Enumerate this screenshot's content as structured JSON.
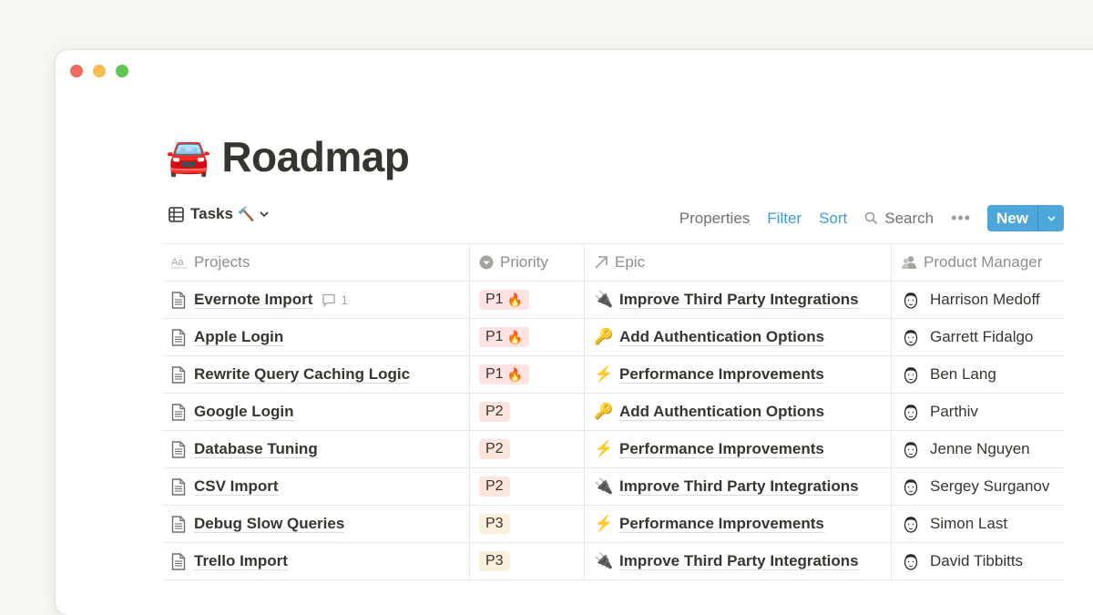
{
  "window": {
    "traffic_lights": [
      {
        "name": "close",
        "color": "#ec6a5e"
      },
      {
        "name": "minimize",
        "color": "#f4bf4f"
      },
      {
        "name": "zoom",
        "color": "#61c554"
      }
    ]
  },
  "page": {
    "emoji": "🚘",
    "title": "Roadmap"
  },
  "toolbar": {
    "view_icon": "table-icon",
    "view_label": "Tasks",
    "view_emoji": "🔨",
    "properties_label": "Properties",
    "filter_label": "Filter",
    "sort_label": "Sort",
    "search_label": "Search",
    "more_label": "•••",
    "new_label": "New",
    "accent_color": "#4ea7da"
  },
  "table": {
    "columns": [
      {
        "label": "Projects",
        "icon": "text-property-icon"
      },
      {
        "label": "Priority",
        "icon": "select-property-icon"
      },
      {
        "label": "Epic",
        "icon": "relation-arrow-icon"
      },
      {
        "label": "Product Manager",
        "icon": "person-property-icon"
      }
    ],
    "priority_colors": {
      "P1": "#ffe2e2",
      "P2": "#fde4dc",
      "P3": "#fbf0dc"
    },
    "rows": [
      {
        "project": "Evernote Import",
        "comments": "1",
        "priority": "P1",
        "priority_emoji": "🔥",
        "epic": "Improve Third Party Integrations",
        "epic_emoji": "🔌",
        "pm": "Harrison Medoff"
      },
      {
        "project": "Apple Login",
        "comments": "",
        "priority": "P1",
        "priority_emoji": "🔥",
        "epic": "Add Authentication Options",
        "epic_emoji": "🔑",
        "pm": "Garrett Fidalgo"
      },
      {
        "project": "Rewrite Query Caching Logic",
        "comments": "",
        "priority": "P1",
        "priority_emoji": "🔥",
        "epic": "Performance Improvements",
        "epic_emoji": "⚡",
        "pm": "Ben Lang"
      },
      {
        "project": "Google Login",
        "comments": "",
        "priority": "P2",
        "priority_emoji": "",
        "epic": "Add Authentication Options",
        "epic_emoji": "🔑",
        "pm": "Parthiv"
      },
      {
        "project": "Database Tuning",
        "comments": "",
        "priority": "P2",
        "priority_emoji": "",
        "epic": "Performance Improvements",
        "epic_emoji": "⚡",
        "pm": "Jenne Nguyen"
      },
      {
        "project": "CSV Import",
        "comments": "",
        "priority": "P2",
        "priority_emoji": "",
        "epic": "Improve Third Party Integrations",
        "epic_emoji": "🔌",
        "pm": "Sergey Surganov"
      },
      {
        "project": "Debug Slow Queries",
        "comments": "",
        "priority": "P3",
        "priority_emoji": "",
        "epic": "Performance Improvements",
        "epic_emoji": "⚡",
        "pm": "Simon Last"
      },
      {
        "project": "Trello Import",
        "comments": "",
        "priority": "P3",
        "priority_emoji": "",
        "epic": "Improve Third Party Integrations",
        "epic_emoji": "🔌",
        "pm": "David Tibbitts"
      }
    ]
  }
}
